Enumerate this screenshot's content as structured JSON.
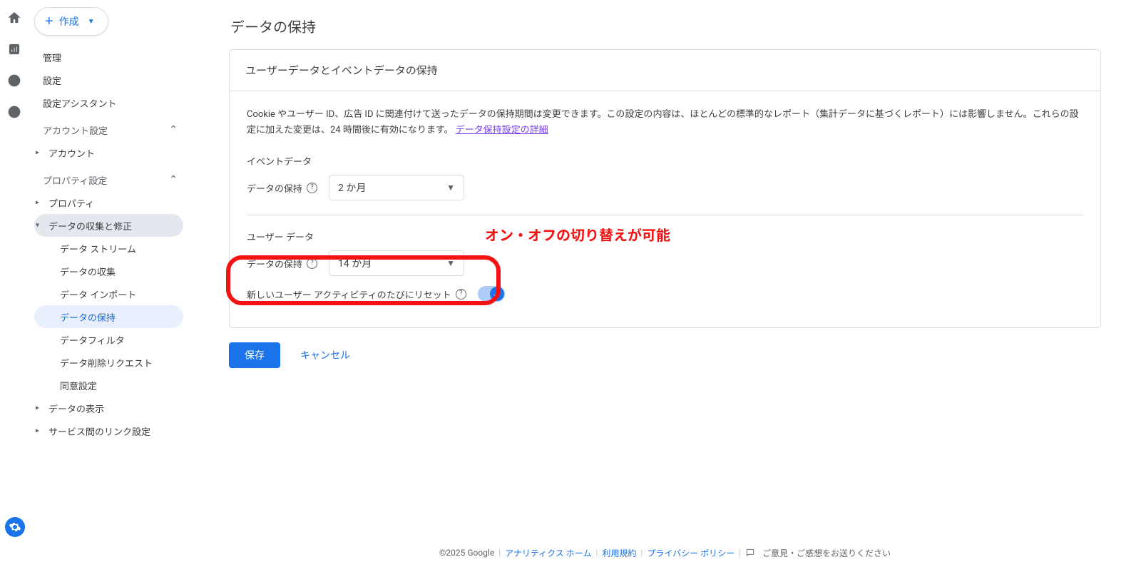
{
  "create_button": "作成",
  "sidebar": {
    "items": [
      {
        "label": "管理"
      },
      {
        "label": "設定"
      },
      {
        "label": "設定アシスタント"
      }
    ],
    "account_group": "アカウント設定",
    "account_child": "アカウント",
    "property_group": "プロパティ設定",
    "property_child": "プロパティ",
    "data_collect": "データの収集と修正",
    "dc_children": [
      "データ ストリーム",
      "データの収集",
      "データ インポート",
      "データの保持",
      "データフィルタ",
      "データ削除リクエスト",
      "同意設定"
    ],
    "data_display": "データの表示",
    "link_settings": "サービス間のリンク設定"
  },
  "page": {
    "title": "データの保持",
    "card_head": "ユーザーデータとイベントデータの保持",
    "desc": "Cookie やユーザー ID、広告 ID に関連付けて送ったデータの保持期間は変更できます。この設定の内容は、ほとんどの標準的なレポート（集計データに基づくレポート）には影響しません。これらの設定に加えた変更は、24 時間後に有効になります。 ",
    "desc_link": "データ保持設定の詳細",
    "event_section": "イベントデータ",
    "retention_label": "データの保持",
    "event_retention_value": "2 か月",
    "user_section": "ユーザー データ",
    "user_retention_value": "14 か月",
    "reset_label": "新しいユーザー アクティビティのたびにリセット",
    "save": "保存",
    "cancel": "キャンセル",
    "annotation": "オン・オフの切り替えが可能"
  },
  "footer": {
    "copyright": "©2025 Google",
    "home": "アナリティクス ホーム",
    "terms": "利用規約",
    "privacy": "プライバシー ポリシー",
    "feedback": "ご意見・ご感想をお送りください"
  }
}
